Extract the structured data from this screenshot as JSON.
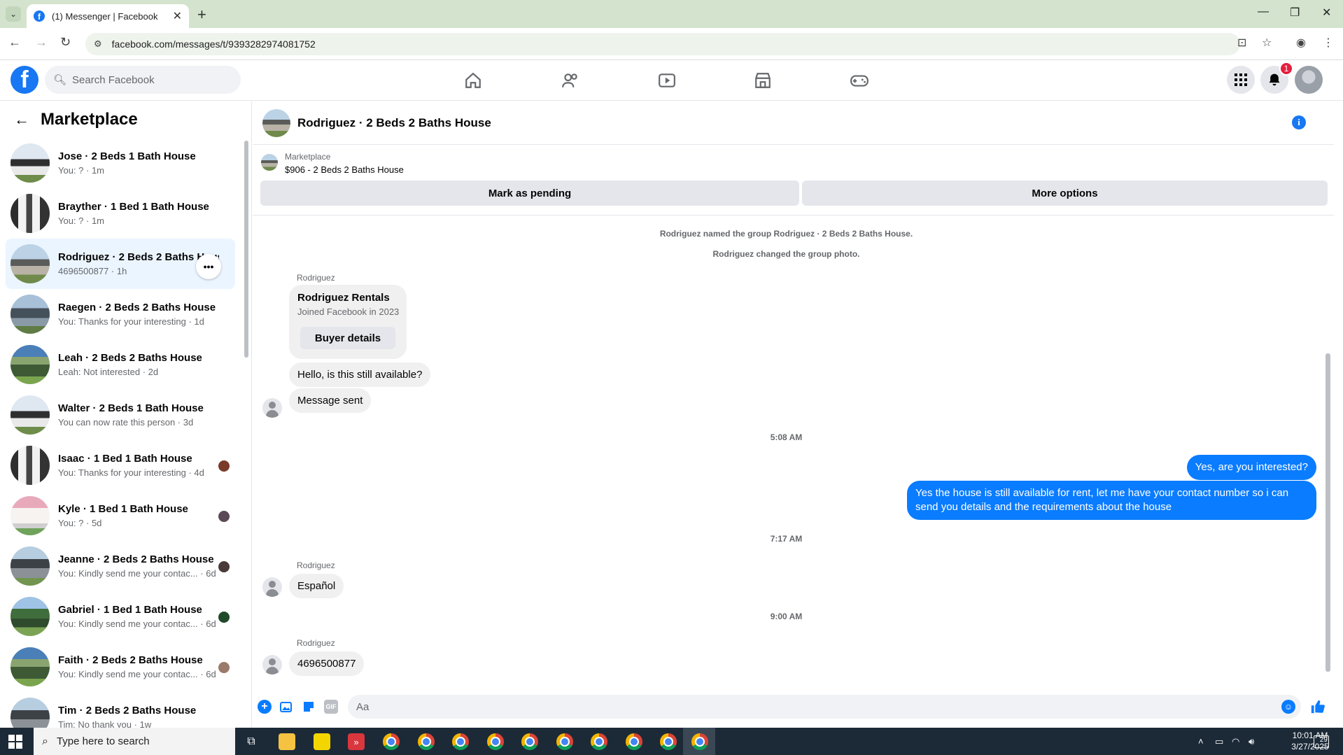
{
  "browser": {
    "tab_title": "(1) Messenger | Facebook",
    "url": "facebook.com/messages/t/9393282974081752"
  },
  "fb": {
    "search_placeholder": "Search Facebook",
    "notification_count": "1"
  },
  "sidebar": {
    "title": "Marketplace",
    "conversations": [
      {
        "name": "Jose · 2 Beds 1 Bath House",
        "snippet": "You: ? · 1m",
        "thumb": "t1"
      },
      {
        "name": "Brayther · 1 Bed 1 Bath House",
        "snippet": "You: ? · 1m",
        "thumb": "t2"
      },
      {
        "name": "Rodriguez · 2 Beds 2 Baths House",
        "snippet": "4696500877 · 1h",
        "thumb": "t3",
        "active": true
      },
      {
        "name": "Raegen · 2 Beds 2 Baths House",
        "snippet": "You: Thanks for your interesting · 1d",
        "thumb": "t4"
      },
      {
        "name": "Leah · 2 Beds 2 Baths House",
        "snippet": "Leah: Not interested · 2d",
        "thumb": "t5"
      },
      {
        "name": "Walter · 2 Beds 1 Bath House",
        "snippet": "You can now rate this person · 3d",
        "thumb": "t1"
      },
      {
        "name": "Isaac · 1 Bed 1 Bath House",
        "snippet": "You: Thanks for your interesting · 4d",
        "thumb": "t2",
        "seen": "#7a3a2a"
      },
      {
        "name": "Kyle · 1 Bed 1 Bath House",
        "snippet": "You: ? · 5d",
        "thumb": "t6",
        "seen": "#5a4a55"
      },
      {
        "name": "Jeanne · 2 Beds 2 Baths House",
        "snippet": "You: Kindly send me your contac... · 6d",
        "thumb": "t7",
        "seen": "#4a3a3a"
      },
      {
        "name": "Gabriel · 1 Bed 1 Bath House",
        "snippet": "You: Kindly send me your contac... · 6d",
        "thumb": "t8",
        "seen": "#1f4a2a"
      },
      {
        "name": "Faith · 2 Beds 2 Baths House",
        "snippet": "You: Kindly send me your contac... · 6d",
        "thumb": "t5",
        "seen": "#9a7a6a"
      },
      {
        "name": "Tim · 2 Beds 2 Baths House",
        "snippet": "Tim: No thank you · 1w",
        "thumb": "t7"
      }
    ]
  },
  "chat": {
    "title": "Rodriguez · 2 Beds 2 Baths House",
    "marketplace_label": "Marketplace",
    "listing": "$906 - 2 Beds 2 Baths House",
    "mark_pending": "Mark as pending",
    "more_options": "More options",
    "sys1": "Rodriguez named the group Rodriguez · 2 Beds 2 Baths House.",
    "sys2": "Rodriguez changed the group photo.",
    "sender": "Rodriguez",
    "card_name": "Rodriguez Rentals",
    "card_sub": "Joined Facebook in 2023",
    "card_button": "Buyer details",
    "msg_hello": "Hello, is this still available?",
    "msg_sent": "Message sent",
    "time1": "5:08 AM",
    "out1": "Yes, are you interested?",
    "out2": "Yes the house is still available for rent, let me have your contact number so i can send you details and the requirements about the house",
    "time2": "7:17 AM",
    "msg_espanol": "Español",
    "time3": "9:00 AM",
    "msg_number": "4696500877",
    "composer_placeholder": "Aa"
  },
  "taskbar": {
    "search_placeholder": "Type here to search",
    "time": "10:01 AM",
    "date": "3/27/2025",
    "notif_count": "29"
  },
  "colors": {
    "accent": "#0a7cff",
    "fb_blue": "#1877f2",
    "badge_red": "#e41e3f"
  }
}
